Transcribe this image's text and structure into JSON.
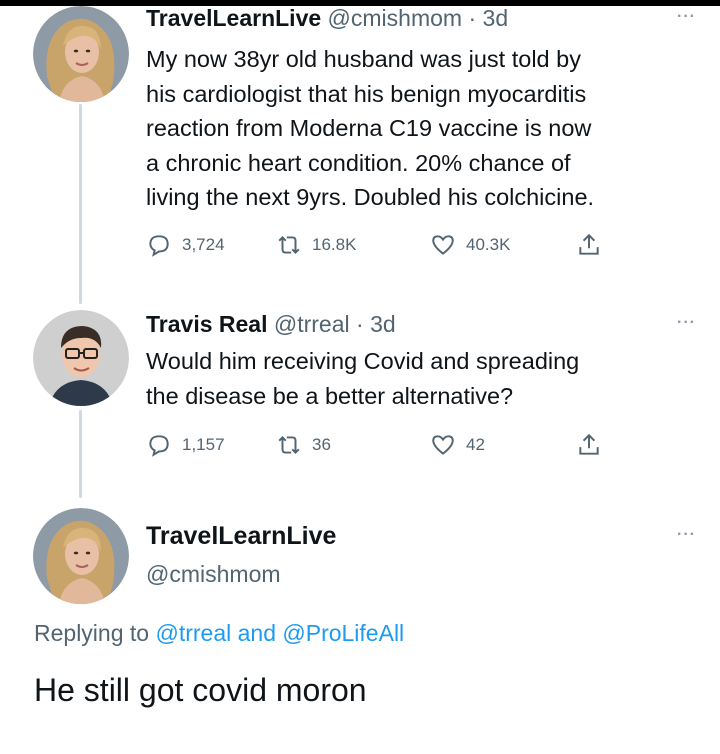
{
  "tweet1": {
    "display_name": "TravelLearnLive",
    "handle": "@cmishmom",
    "separator": "·",
    "time": "3d",
    "text_lines": [
      "My now 38yr old husband was just told by",
      "his cardiologist that his benign myocarditis",
      "reaction from Moderna C19 vaccine is now",
      "a chronic heart condition. 20% chance of",
      "living the next 9yrs. Doubled his colchicine."
    ],
    "stats": {
      "replies": "3,724",
      "retweets": "16.8K",
      "likes": "40.3K"
    }
  },
  "tweet2": {
    "display_name": "Travis Real",
    "handle": "@trreal",
    "separator": "·",
    "time": "3d",
    "text_lines": [
      "Would him receiving Covid and spreading",
      "the disease be a better alternative?"
    ],
    "stats": {
      "replies": "1,157",
      "retweets": "36",
      "likes": "42"
    }
  },
  "tweet3": {
    "display_name": "TravelLearnLive",
    "handle": "@cmishmom",
    "replying_prefix": "Replying to",
    "replying_mention1": "@trreal",
    "replying_and": "and",
    "replying_mention2": "@ProLifeAll",
    "text": "He still got covid moron"
  },
  "icons": {
    "more": "more-options-icon",
    "reply": "reply-icon",
    "retweet": "retweet-icon",
    "like": "heart-icon",
    "share": "share-icon"
  },
  "colors": {
    "text": "#0f1419",
    "secondary": "#536471",
    "link": "#1d9bf0",
    "thread_line": "#cfd9de"
  }
}
